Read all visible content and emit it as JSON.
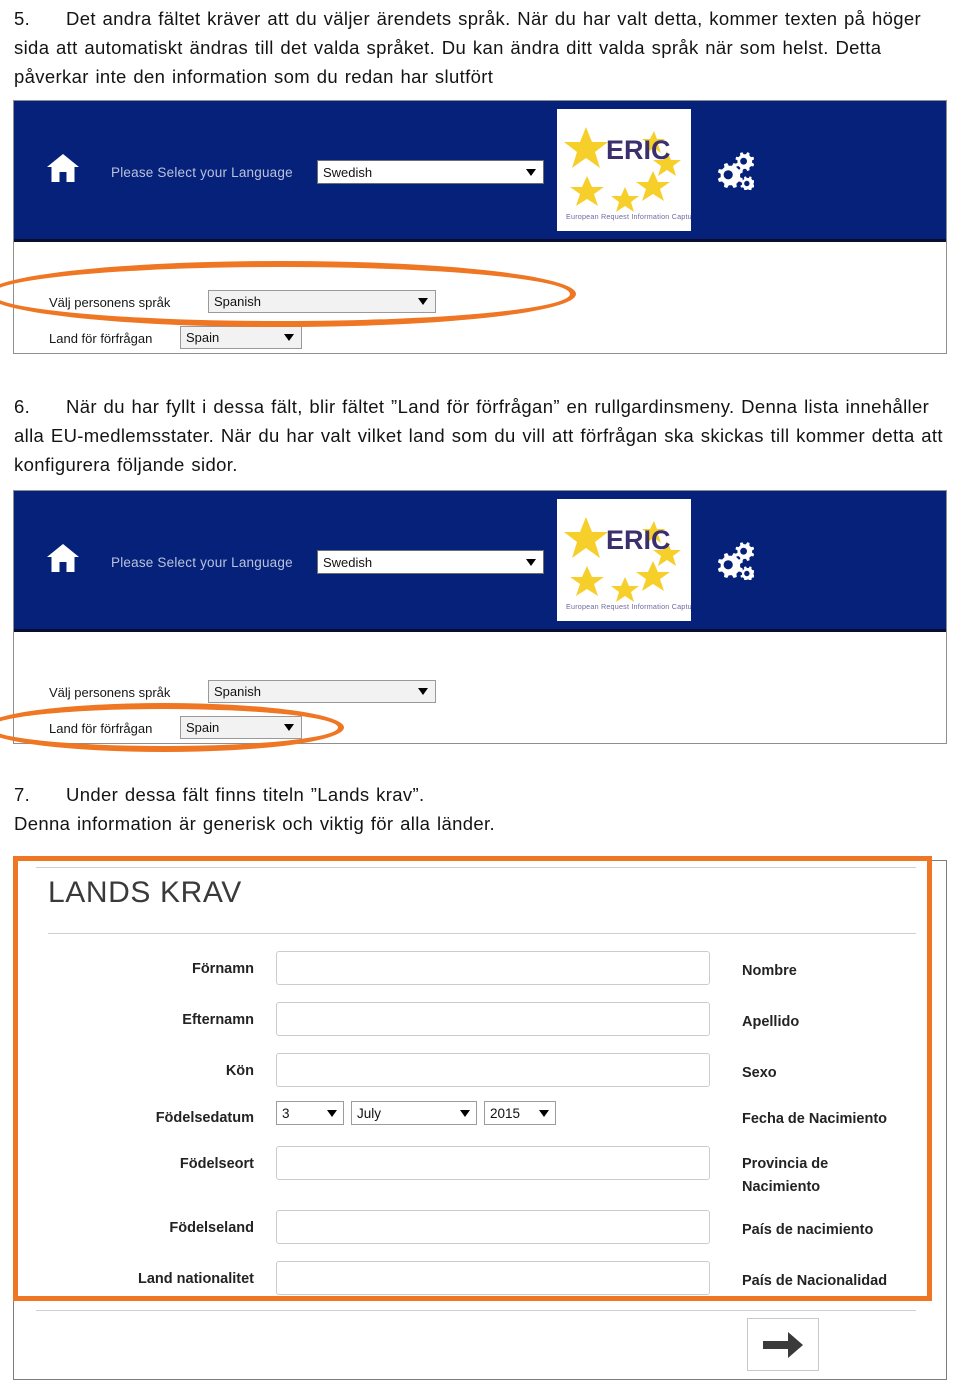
{
  "document": {
    "step5": {
      "number": "5.",
      "text": "Det andra fältet kräver att du väljer ärendets språk. När du har valt detta, kommer texten på höger sida att automatiskt ändras till det valda språket. Du kan ändra ditt valda språk när som helst. Detta påverkar inte den information som du redan har slutfört"
    },
    "step6": {
      "number": "6.",
      "text": "När du har fyllt i dessa fält, blir fältet ”Land för förfrågan” en rullgardinsmeny. Denna lista innehåller alla EU-medlemsstater. När du har valt vilket land som du vill att förfrågan ska skickas till kommer detta att konfigurera följande sidor."
    },
    "step7": {
      "number": "7.",
      "text": "Under dessa fält finns titeln ”Lands krav”.",
      "text2": "Denna information är generisk och viktig för alla länder."
    }
  },
  "app": {
    "header": {
      "home_icon": "home-icon",
      "language_prompt": "Please Select your Language",
      "language_value": "Swedish",
      "gears_icon": "gears-icon"
    },
    "logo": {
      "brand": "ERIC",
      "tagline": "European Request Information Capture"
    },
    "fields": {
      "person_language_label": "Välj personens språk",
      "person_language_value": "Spanish",
      "request_country_label": "Land för förfrågan",
      "request_country_value": "Spain"
    }
  },
  "form": {
    "title": "LANDS KRAV",
    "rows": [
      {
        "sv": "Förnamn",
        "es": "Nombre",
        "type": "text"
      },
      {
        "sv": "Efternamn",
        "es": "Apellido",
        "type": "text"
      },
      {
        "sv": "Kön",
        "es": "Sexo",
        "type": "text"
      },
      {
        "sv": "Födelsedatum",
        "es": "Fecha de Nacimiento",
        "type": "date"
      },
      {
        "sv": "Födelseort",
        "es": "Provincia de Nacimiento",
        "type": "text"
      },
      {
        "sv": "Födelseland",
        "es": "País de nacimiento",
        "type": "text"
      },
      {
        "sv": "Land nationalitet",
        "es": "País de Nacionalidad",
        "type": "text"
      }
    ],
    "date": {
      "day": "3",
      "month": "July",
      "year": "2015"
    },
    "next_icon": "arrow-right-icon"
  },
  "colors": {
    "header_blue": "#05217a",
    "highlight_orange": "#ef7622",
    "logo_yellow": "#f6cf2a",
    "logo_text": "#3b2f6e"
  }
}
